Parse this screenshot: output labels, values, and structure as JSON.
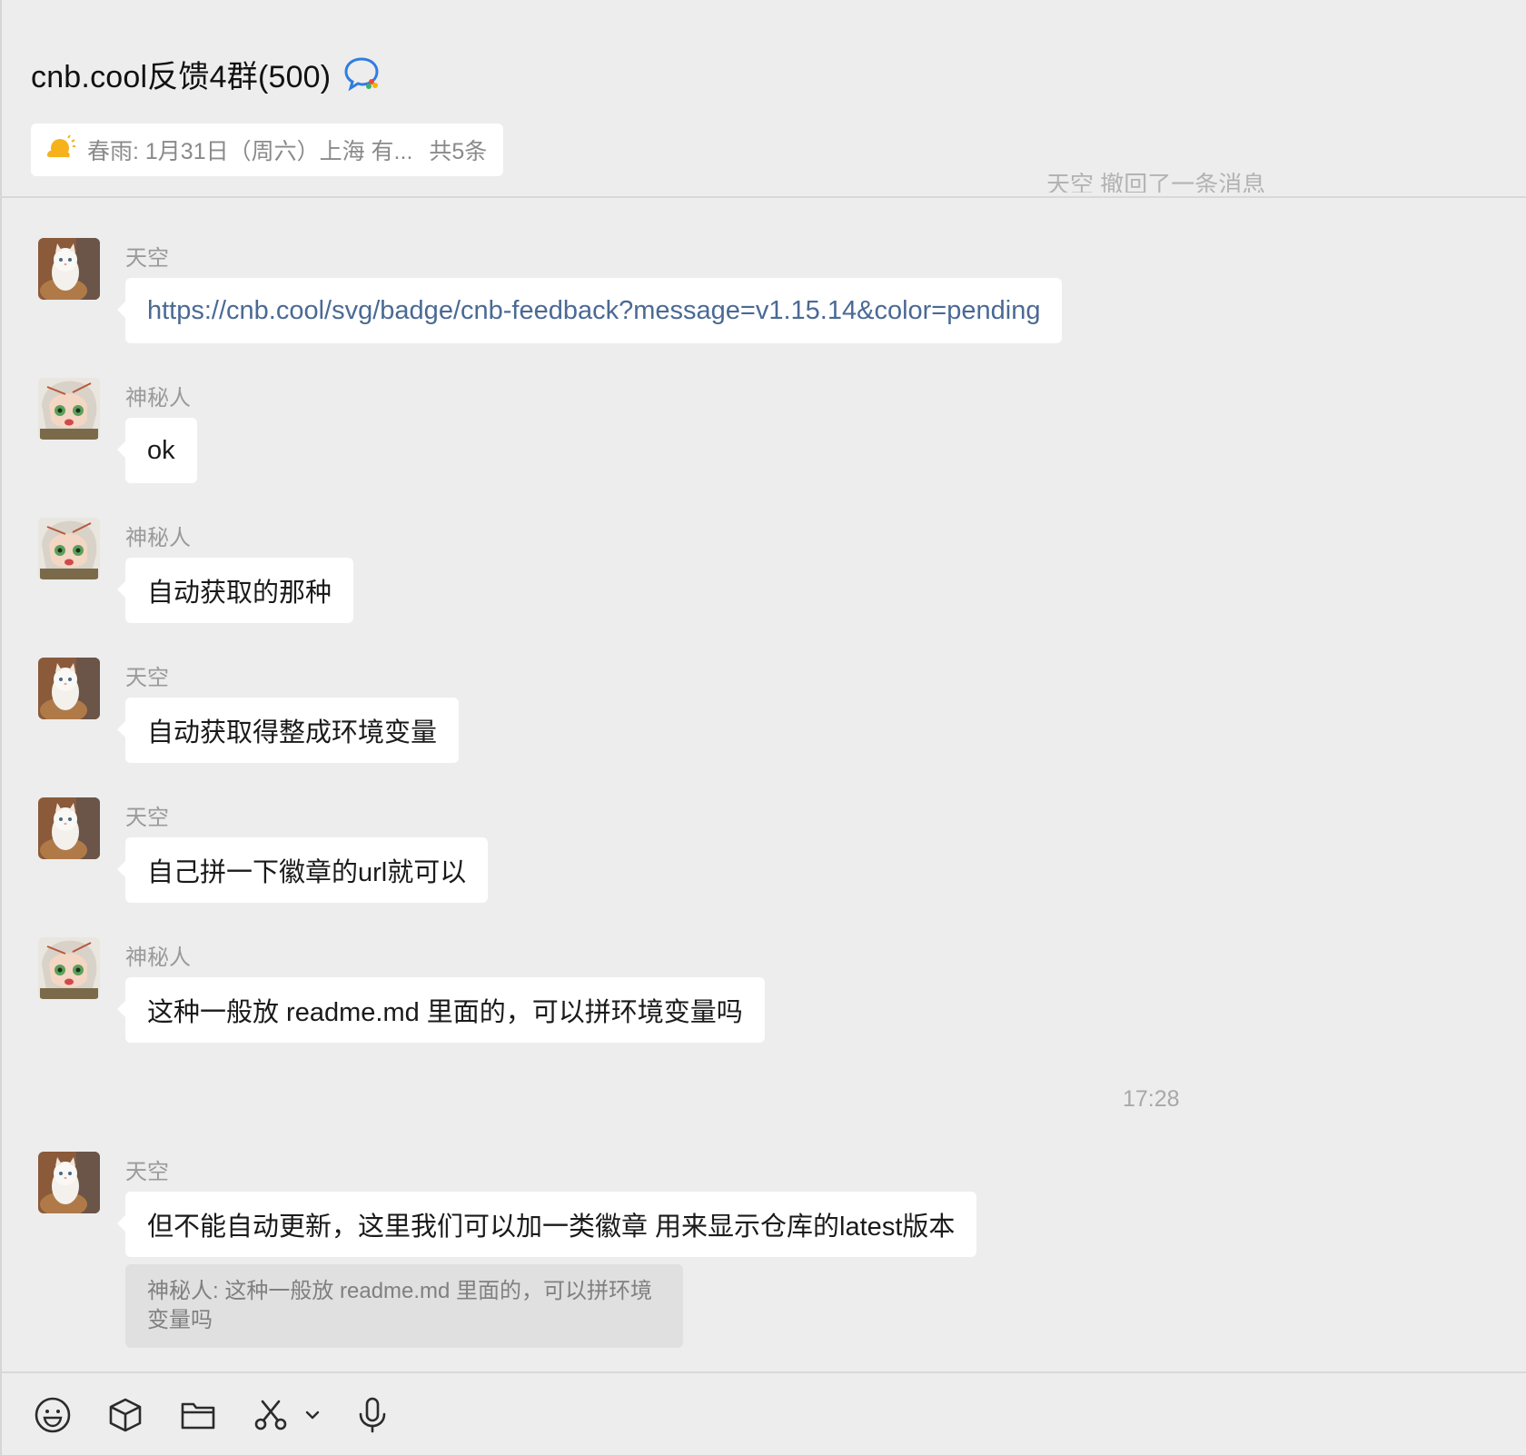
{
  "header": {
    "title": "cnb.cool反馈4群(500)",
    "title_icon": "chat-bubble-icon",
    "notice_text": "春雨: 1月31日（周六）上海 有...",
    "notice_count": "共5条",
    "notice_icon": "weather-sun-cloud-icon"
  },
  "system_clipped": "天空 撤回了一条消息",
  "messages": [
    {
      "sender": "天空",
      "text": "https://cnb.cool/svg/badge/cnb-feedback?message=v1.15.14&color=pending",
      "is_link": true
    },
    {
      "sender": "神秘人",
      "text": "ok"
    },
    {
      "sender": "神秘人",
      "text": "自动获取的那种"
    },
    {
      "sender": "天空",
      "text": "自动获取得整成环境变量"
    },
    {
      "sender": "天空",
      "text": "自己拼一下徽章的url就可以"
    },
    {
      "sender": "神秘人",
      "text": "这种一般放 readme.md 里面的，可以拼环境变量吗"
    },
    {
      "sender": "天空",
      "text": "但不能自动更新，这里我们可以加一类徽章 用来显示仓库的latest版本",
      "quote": "神秘人: 这种一般放 readme.md 里面的，可以拼环境变量吗"
    }
  ],
  "timestamp": "17:28",
  "toolbar": {
    "items": [
      "emoji-icon",
      "sticker-box-icon",
      "folder-icon",
      "scissors-screenshot-icon",
      "chevron-down-icon",
      "microphone-icon"
    ]
  },
  "colors": {
    "background": "#ededed",
    "bubble": "#ffffff",
    "link": "#4a6a94",
    "quote_bg": "#e0e0e0"
  }
}
